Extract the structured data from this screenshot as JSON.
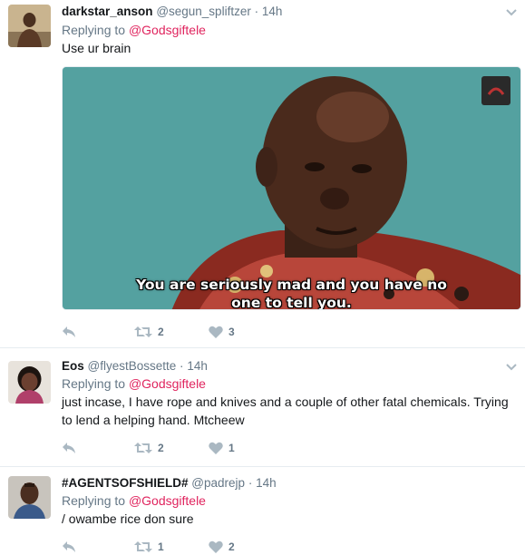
{
  "tweets": [
    {
      "name": "darkstar_anson",
      "handle": "@segun_spliftzer",
      "sep": "·",
      "time": "14h",
      "replying_prefix": "Replying to",
      "replying_to": "@Godsgiftele",
      "text": "Use ur brain",
      "media": {
        "caption_line1": "You are seriously mad and you have no",
        "caption_line2": "one to tell you."
      },
      "retweets": "2",
      "likes": "3"
    },
    {
      "name": "Eos",
      "handle": "@flyestBossette",
      "sep": "·",
      "time": "14h",
      "replying_prefix": "Replying to",
      "replying_to": "@Godsgiftele",
      "text": "just incase, I have rope and knives and a couple of other fatal chemicals. Trying to lend a helping hand. Mtcheew",
      "retweets": "2",
      "likes": "1"
    },
    {
      "name": "#AGENTSOFSHIELD#",
      "handle": "@padrejp",
      "sep": "·",
      "time": "14h",
      "replying_prefix": "Replying to",
      "replying_to": "@Godsgiftele",
      "text": "/ owambe rice don sure",
      "retweets": "1",
      "likes": "2"
    }
  ],
  "icons": {
    "reply": "reply-icon",
    "retweet": "retweet-icon",
    "like": "heart-icon",
    "more": "chevron-down-icon"
  },
  "colors": {
    "mention": "#e0245e",
    "secondary": "#657786",
    "icon": "#aab8c2",
    "divider": "#e6ecf0"
  }
}
